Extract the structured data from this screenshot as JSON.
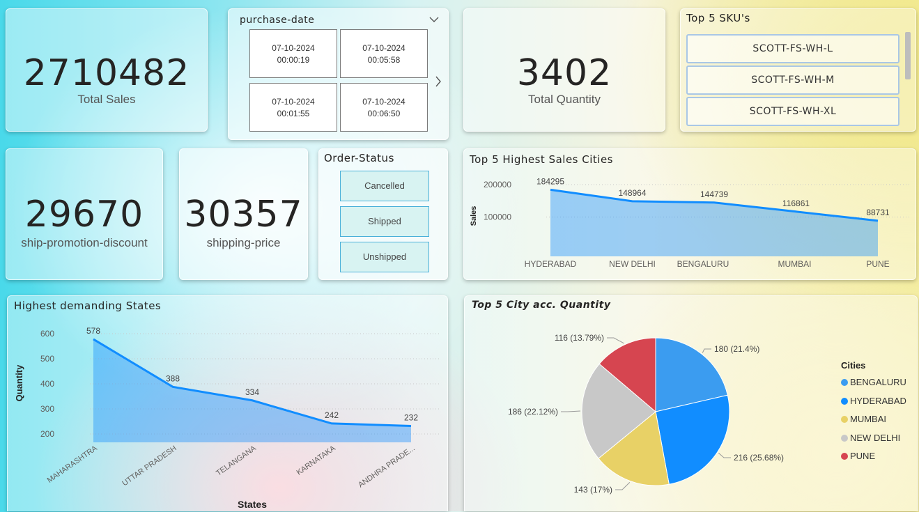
{
  "kpis": {
    "total_sales": {
      "value": "2710482",
      "label": "Total Sales"
    },
    "total_quantity": {
      "value": "3402",
      "label": "Total Quantity"
    },
    "ship_promotion_discount": {
      "value": "29670",
      "label": "ship-promotion-discount"
    },
    "shipping_price": {
      "value": "30357",
      "label": "shipping-price"
    }
  },
  "purchase_date": {
    "title": "purchase-date",
    "cells": [
      {
        "date": "07-10-2024",
        "time": "00:00:19"
      },
      {
        "date": "07-10-2024",
        "time": "00:05:58"
      },
      {
        "date": "07-10-2024",
        "time": "00:01:55"
      },
      {
        "date": "07-10-2024",
        "time": "00:06:50"
      }
    ]
  },
  "top_skus": {
    "title": "Top 5 SKU's",
    "items": [
      "SCOTT-FS-WH-L",
      "SCOTT-FS-WH-M",
      "SCOTT-FS-WH-XL"
    ]
  },
  "order_status": {
    "title": "Order-Status",
    "items": [
      "Cancelled",
      "Shipped",
      "Unshipped"
    ]
  },
  "chart_data": [
    {
      "type": "area",
      "title": "Top 5 Highest Sales Cities",
      "ylabel": "Sales",
      "xlabel": "",
      "categories": [
        "HYDERABAD",
        "NEW DELHI",
        "BENGALURU",
        "MUMBAI",
        "PUNE"
      ],
      "values": [
        184295,
        148964,
        144739,
        116861,
        88731
      ],
      "yticks": [
        "200000",
        "100000"
      ],
      "ylim": [
        50000,
        200000
      ],
      "grid": true,
      "color": "#118DFF"
    },
    {
      "type": "area",
      "title": "Highest demanding States",
      "ylabel": "Quantity",
      "xlabel": "States",
      "categories": [
        "MAHARASHTRA",
        "UTTAR PRADESH",
        "TELANGANA",
        "KARNATAKA",
        "ANDHRA PRADE..."
      ],
      "values": [
        578,
        388,
        334,
        242,
        232
      ],
      "yticks": [
        "600",
        "500",
        "400",
        "300",
        "200"
      ],
      "ylim": [
        200,
        600
      ],
      "grid": true,
      "color": "#118DFF"
    },
    {
      "type": "pie",
      "title": "Top 5 City acc. Quantity",
      "legend_title": "Cities",
      "legend_position": "right",
      "slices": [
        {
          "label": "BENGALURU",
          "value": 180,
          "display": "180 (21.4%)",
          "color": "#3b9cf0"
        },
        {
          "label": "HYDERABAD",
          "value": 216,
          "display": "216 (25.68%)",
          "color": "#118DFF"
        },
        {
          "label": "MUMBAI",
          "value": 143,
          "display": "143 (17%)",
          "color": "#E8D166"
        },
        {
          "label": "NEW DELHI",
          "value": 186,
          "display": "186 (22.12%)",
          "color": "#C8C8C8"
        },
        {
          "label": "PUNE",
          "value": 116,
          "display": "116 (13.79%)",
          "color": "#D64550"
        }
      ]
    }
  ]
}
